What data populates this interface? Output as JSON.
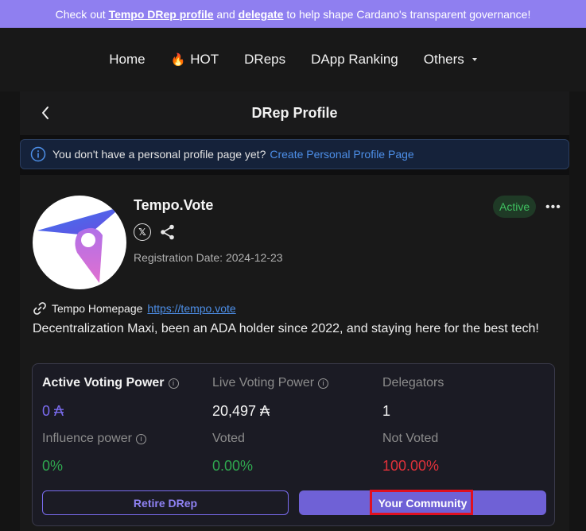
{
  "banner": {
    "prefix": "Check out ",
    "link1": "Tempo DRep profile",
    "middle": " and ",
    "link2": "delegate",
    "suffix": " to help shape Cardano's transparent governance!"
  },
  "nav": {
    "home": "Home",
    "hot_emoji": "🔥",
    "hot": "HOT",
    "dreps": "DReps",
    "dapp_ranking": "DApp Ranking",
    "others": "Others"
  },
  "header": {
    "title": "DRep Profile"
  },
  "notice": {
    "text": "You don't have a personal profile page yet?",
    "link": "Create Personal Profile Page"
  },
  "profile": {
    "name": "Tempo.Vote",
    "status": "Active",
    "registration": "Registration Date: 2024-12-23",
    "homepage_label": "Tempo Homepage",
    "homepage_url": "https://tempo.vote",
    "bio": "Decentralization Maxi, been an ADA holder since 2022, and staying here for the best tech!"
  },
  "stats": {
    "active_voting_power_label": "Active Voting Power",
    "active_voting_power_value": "0 ₳",
    "live_voting_power_label": "Live Voting Power",
    "live_voting_power_value": "20,497 ₳",
    "delegators_label": "Delegators",
    "delegators_value": "1",
    "influence_label": "Influence power",
    "influence_value": "0%",
    "voted_label": "Voted",
    "voted_value": "0.00%",
    "not_voted_label": "Not Voted",
    "not_voted_value": "100.00%"
  },
  "buttons": {
    "retire": "Retire DRep",
    "community": "Your Community"
  },
  "colors": {
    "accent": "#6f61d6",
    "active_green": "#3fc060",
    "voted_green": "#2fa84f",
    "not_voted_red": "#e0313a",
    "purple_value": "#7b6cf0"
  }
}
